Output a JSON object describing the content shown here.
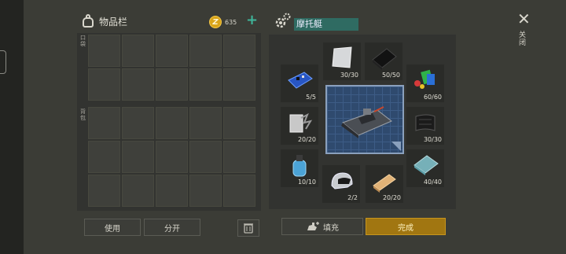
{
  "inventory": {
    "title": "物品栏",
    "coins": "635",
    "sections": [
      {
        "label": "口袋"
      },
      {
        "label": "背包"
      }
    ],
    "buttons": {
      "use": "使用",
      "split": "分开"
    }
  },
  "crafting": {
    "item_name": "摩托艇",
    "materials": [
      {
        "name": "metal-sheet",
        "qty": "30/30"
      },
      {
        "name": "rubber-roll",
        "qty": "50/50"
      },
      {
        "name": "circuit-board",
        "qty": "5/5"
      },
      {
        "name": "colored-chemicals",
        "qty": "60/60"
      },
      {
        "name": "scrap-metal",
        "qty": "20/20"
      },
      {
        "name": "carbon-fabric",
        "qty": "30/30"
      },
      {
        "name": "gas-tank",
        "qty": "10/10"
      },
      {
        "name": "helmet",
        "qty": "2/2"
      },
      {
        "name": "wood-plank",
        "qty": "20/20"
      },
      {
        "name": "glass-panel",
        "qty": "40/40"
      }
    ],
    "fill_label": "填充",
    "done_label": "完成"
  },
  "close": {
    "label": "关闭"
  },
  "colors": {
    "accent_gold": "#a17611",
    "teal": "#2f6b62",
    "plus_green": "#3fb59a"
  }
}
